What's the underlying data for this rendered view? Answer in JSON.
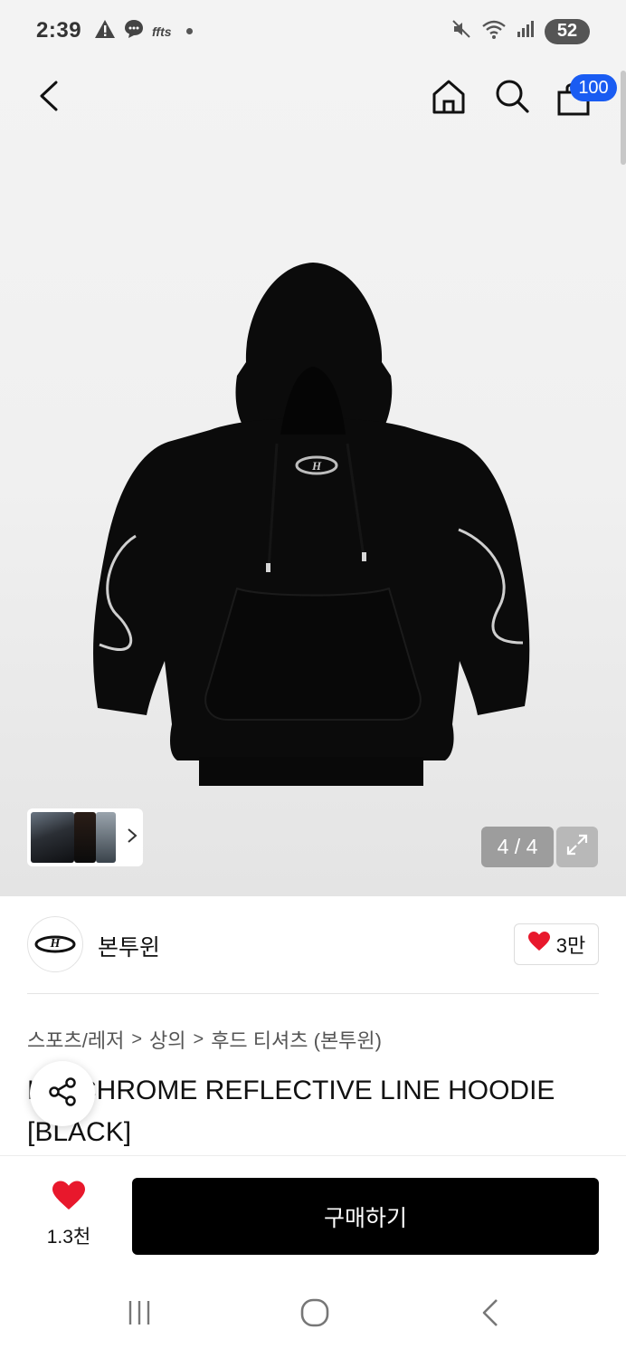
{
  "status_bar": {
    "time": "2:39",
    "battery": "52",
    "notif_text": "ffts",
    "icons_left": [
      "warning-icon",
      "message-icon",
      "app-icon",
      "dot-icon"
    ],
    "icons_right": [
      "mute-icon",
      "wifi-icon",
      "signal-icon",
      "battery-icon"
    ]
  },
  "top_bar": {
    "icons": [
      "back-icon",
      "home-icon",
      "search-icon",
      "bag-icon"
    ],
    "cart_count": "100"
  },
  "gallery": {
    "page_indicator": "4 / 4",
    "more_thumbnails_icon": "chevron-right-icon",
    "expand_icon": "expand-icon",
    "hoodie_logo_text": "H"
  },
  "brand": {
    "logo_text": "H",
    "name": "본투윈",
    "like_count": "3만"
  },
  "breadcrumb": {
    "items": [
      "스포츠/레저",
      "상의",
      "후드 티셔츠 (본투윈)"
    ],
    "separator": ">"
  },
  "product": {
    "title": "H... CHROME REFLECTIVE LINE HOODIE [BLACK]",
    "title_visible": "CHROME REFLECTIVE LINE HOODI E [BLACK]"
  },
  "bottom_bar": {
    "favorite_count": "1.3천",
    "buy_label": "구매하기"
  },
  "nav_bar": {
    "items": [
      "recents-icon",
      "home-button-icon",
      "back-nav-icon"
    ]
  },
  "colors": {
    "accent_blue": "#1a5cf2",
    "heart_red": "#e8182c",
    "buy_button": "#000000"
  }
}
